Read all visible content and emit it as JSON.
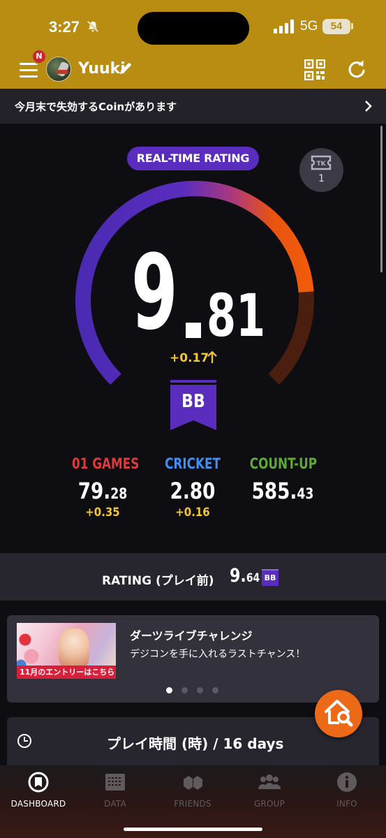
{
  "status_bar": {
    "time": "3:27",
    "network": "5G",
    "battery": "54"
  },
  "header": {
    "notification_badge": "N",
    "username": "Yuuki"
  },
  "coin_banner": {
    "text": "今月末で失効するCoinがあります"
  },
  "rating": {
    "badge_label": "REAL-TIME RATING",
    "ticket_count": "1",
    "integer": "9",
    "decimal": "81",
    "delta": "+0.17",
    "class": "BB",
    "gauge_value": 9.81
  },
  "stats": [
    {
      "label": "01 GAMES",
      "value_big": "79.",
      "value_small": "28",
      "delta": "+0.35",
      "color": "#e0383d"
    },
    {
      "label": "CRICKET",
      "value_big": "2.80",
      "value_small": "",
      "delta": "+0.16",
      "color": "#3f8ef0"
    },
    {
      "label": "COUNT-UP",
      "value_big": "585.",
      "value_small": "43",
      "delta": "",
      "color": "#5ea93a"
    }
  ],
  "rating_before": {
    "label": "RATING (プレイ前)",
    "value_big": "9.",
    "value_small": "64",
    "class": "BB"
  },
  "event": {
    "title": "ダーツライブチャレンジ",
    "subtitle": "デジコンを手に入れるラストチャンス！",
    "image_caption": "11月のエントリーはこちら ▶"
  },
  "playtime": {
    "title": "プレイ時間 (時) / 16 days"
  },
  "tabs": [
    {
      "label": "DASHBOARD",
      "icon": "dashboard-icon",
      "active": true
    },
    {
      "label": "DATA",
      "icon": "data-icon",
      "active": false
    },
    {
      "label": "FRIENDS",
      "icon": "friends-icon",
      "active": false
    },
    {
      "label": "GROUP",
      "icon": "group-icon",
      "active": false
    },
    {
      "label": "INFO",
      "icon": "info-icon",
      "active": false
    }
  ],
  "colors": {
    "header_gold": "#b88d12",
    "accent_purple": "#5a2dbe",
    "accent_orange": "#ec6a17",
    "delta_yellow": "#f2c832"
  }
}
